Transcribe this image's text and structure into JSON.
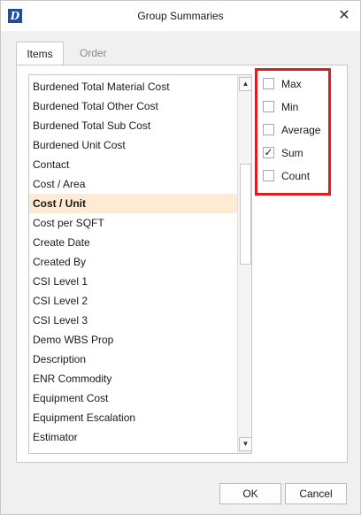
{
  "window": {
    "title": "Group Summaries",
    "app_icon_text": "D",
    "close_glyph": "✕"
  },
  "tabs": [
    {
      "label": "Items",
      "active": true
    },
    {
      "label": "Order",
      "active": false
    }
  ],
  "list": {
    "items": [
      "Burdened Total Material Cost",
      "Burdened Total Other Cost",
      "Burdened Total Sub Cost",
      "Burdened Unit Cost",
      "Contact",
      "Cost / Area",
      "Cost / Unit",
      "Cost per SQFT",
      "Create Date",
      "Created By",
      "CSI Level 1",
      "CSI Level 2",
      "CSI Level 3",
      "Demo WBS Prop",
      "Description",
      "ENR Commodity",
      "Equipment Cost",
      "Equipment Escalation",
      "Estimator"
    ],
    "selected_index": 6,
    "scroll_up_glyph": "▲",
    "scroll_down_glyph": "▼"
  },
  "aggregates": [
    {
      "label": "Max",
      "checked": false
    },
    {
      "label": "Min",
      "checked": false
    },
    {
      "label": "Average",
      "checked": false
    },
    {
      "label": "Sum",
      "checked": true
    },
    {
      "label": "Count",
      "checked": false
    }
  ],
  "highlight_color": "#e21b1b",
  "selected_row_color": "#fdebd3",
  "buttons": {
    "ok": "OK",
    "cancel": "Cancel"
  }
}
